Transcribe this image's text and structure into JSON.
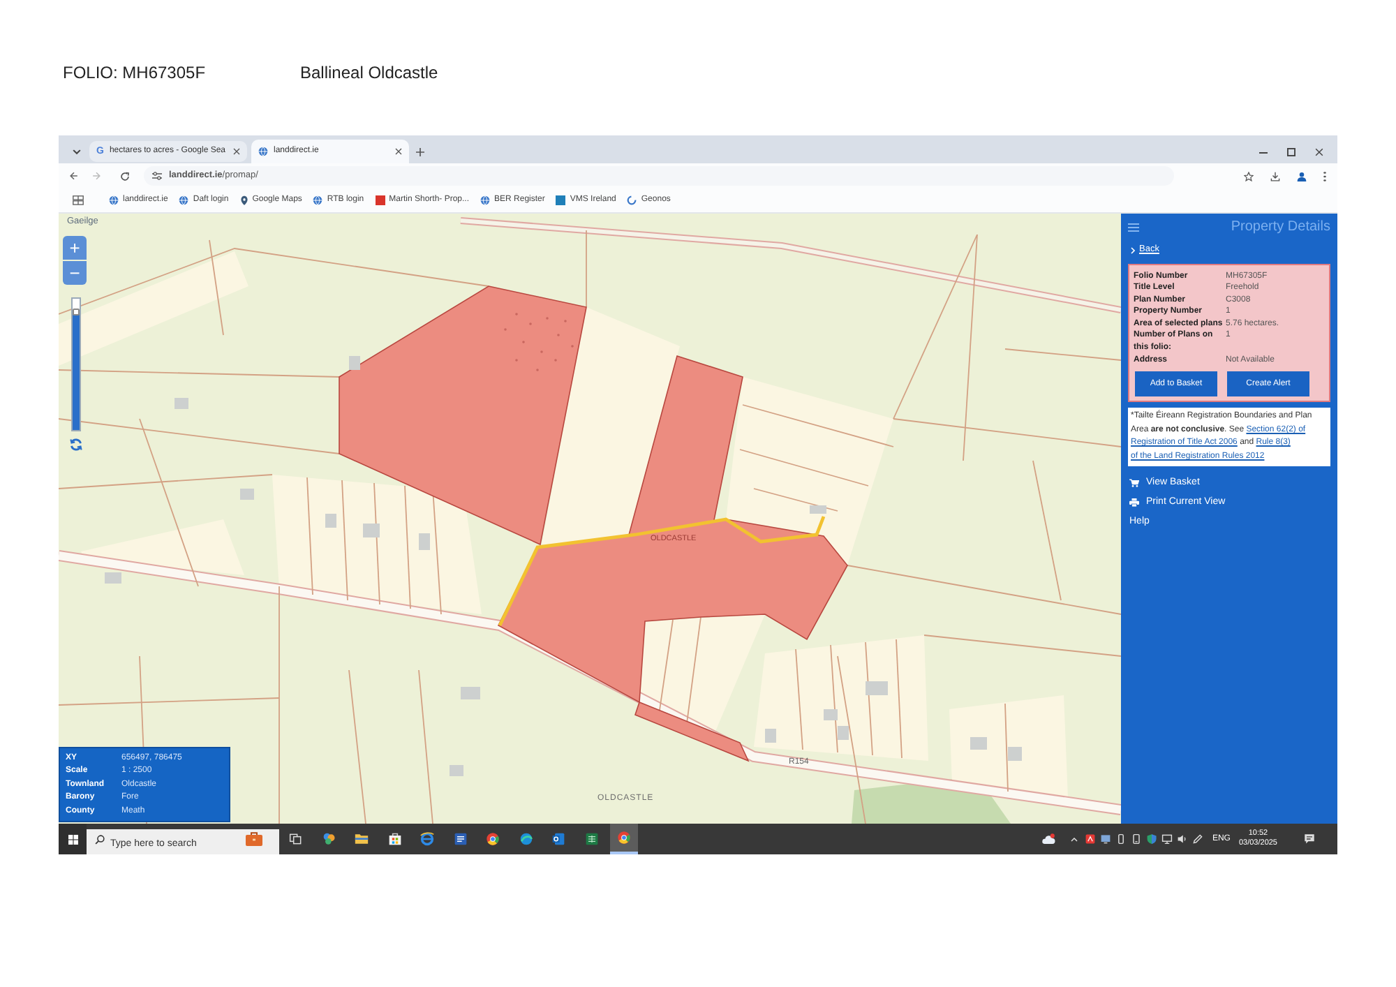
{
  "document": {
    "folio": "FOLIO: MH67305F",
    "place": "Ballineal Oldcastle"
  },
  "browser": {
    "tabs": [
      {
        "kind": "letter",
        "favicon": "G",
        "title": "hectares to acres - Google Sea",
        "selected": false
      },
      {
        "kind": "globe",
        "title": "landdirect.ie",
        "selected": true
      }
    ],
    "address": "**landdirect.ie**/promap/",
    "bookmarks": [
      {
        "kind": "globe",
        "label": "landdirect.ie"
      },
      {
        "kind": "globe",
        "label": "Daft login"
      },
      {
        "kind": "pin",
        "label": "Google Maps"
      },
      {
        "kind": "globe",
        "label": "RTB login"
      },
      {
        "kind": "tile",
        "color": "#d9342b",
        "label": "Martin Shorth- Prop..."
      },
      {
        "kind": "globe",
        "label": "BER Register"
      },
      {
        "kind": "tile",
        "color": "#1f7fb8",
        "label": "VMS Ireland"
      },
      {
        "kind": "ring",
        "label": "Geonos"
      }
    ]
  },
  "map": {
    "language_link": "Gaeilge",
    "zoom_in": "+",
    "zoom_out": "−",
    "zoom_slider": {
      "level": 0.88
    },
    "labels": [
      {
        "kind": "parcel",
        "text": "OLDCASTLE"
      },
      {
        "kind": "road",
        "text": "R154"
      },
      {
        "kind": "area",
        "text": "OLDCASTLE"
      }
    ],
    "info": [
      {
        "label": "XY",
        "value": "656497, 786475"
      },
      {
        "label": "Scale",
        "value": "1 : 2500"
      },
      {
        "label": "Townland",
        "value": "Oldcastle"
      },
      {
        "label": "Barony",
        "value": "Fore"
      },
      {
        "label": "County",
        "value": "Meath"
      }
    ]
  },
  "panel": {
    "title": "Property Details",
    "back": "Back",
    "details": [
      {
        "label": "Folio Number",
        "value": "MH67305F"
      },
      {
        "label": "Title Level",
        "value": "Freehold"
      },
      {
        "label": "Plan Number",
        "value": "C3008"
      },
      {
        "label": "Property Number",
        "value": "1"
      },
      {
        "label": "Area of selected plans",
        "value": "5.76 hectares."
      },
      {
        "label": "Number of Plans on this folio:",
        "value": "1"
      },
      {
        "label": "Address",
        "value": "Not Available"
      }
    ],
    "actions": [
      "Add to Basket",
      "Create Alert"
    ],
    "notice": [
      {
        "kind": "text",
        "text": "*Tailte Éireann Registration Boundaries and Plan Area **are not conclusive**. See"
      },
      {
        "kind": "link",
        "text": "Section 62(2) of"
      },
      {
        "kind": "link",
        "text": "Registration of Title Act 2006"
      },
      {
        "kind": "text",
        "text": "and"
      },
      {
        "kind": "link",
        "text": "Rule 8(3)"
      },
      {
        "kind": "link",
        "text": "of the Land Registration Rules 2012"
      }
    ],
    "menu": [
      {
        "kind": "basket",
        "label": "View Basket"
      },
      {
        "kind": "print",
        "label": "Print Current View"
      },
      {
        "kind": "plain",
        "label": "Help"
      }
    ]
  },
  "taskbar": {
    "search": {
      "placeholder": "Type here to search"
    },
    "apps": [
      {
        "kind": "task-view",
        "active": false
      },
      {
        "kind": "multicolor",
        "active": false
      },
      {
        "kind": "folder",
        "active": false
      },
      {
        "kind": "store",
        "active": false
      },
      {
        "kind": "browser-e",
        "active": false
      },
      {
        "kind": "doc",
        "active": false
      },
      {
        "kind": "ring",
        "active": false
      },
      {
        "kind": "sphere",
        "active": false
      },
      {
        "kind": "mail",
        "active": false
      },
      {
        "kind": "sheet",
        "active": false
      },
      {
        "kind": "ring",
        "active": true
      }
    ],
    "language": "ENG",
    "time": "10:52",
    "date": "03/03/2025"
  }
}
